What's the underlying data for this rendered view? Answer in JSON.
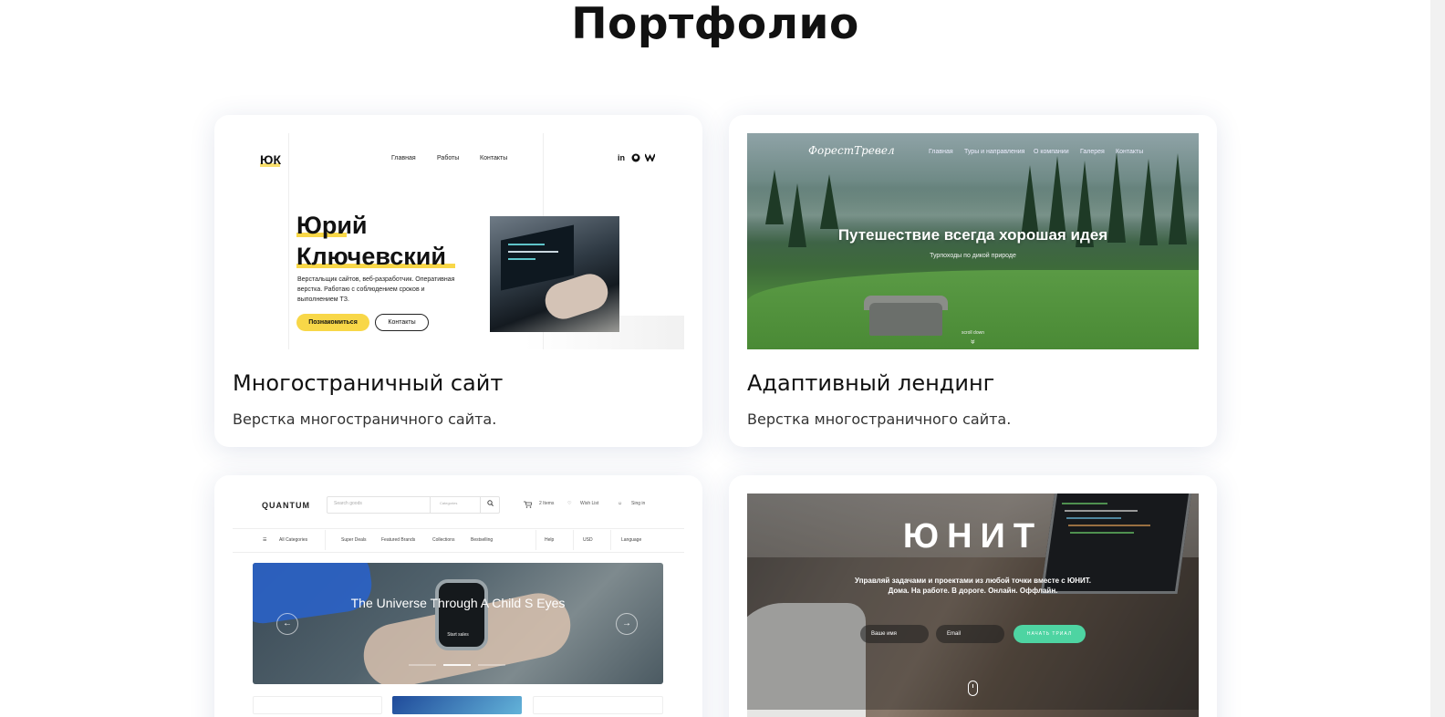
{
  "page": {
    "title": "Портфолио"
  },
  "cards": [
    {
      "title": "Многостраничный сайт",
      "desc": "Верстка многостраничного сайта.",
      "preview": {
        "logo": "ЮК",
        "nav": [
          "Главная",
          "Работы",
          "Контакты"
        ],
        "social": [
          "in",
          "gh",
          "vk"
        ],
        "name_line1": "Юрий",
        "name_line2": "Ключевский",
        "text": "Верстальщик сайтов, веб-разработчик. Оперативная верстка. Работаю с соблюдением сроков и выполнением ТЗ.",
        "btn_primary": "Познакомиться",
        "btn_secondary": "Контакты",
        "accent": "#f8d748"
      }
    },
    {
      "title": "Адаптивный лендинг",
      "desc": "Верстка многостраничного сайта.",
      "preview": {
        "logo": "ФорестТревел",
        "nav": [
          "Главная",
          "Туры и направления",
          "О компании",
          "Галерея",
          "Контакты"
        ],
        "hero": "Путешествие всегда хорошая идея",
        "sub": "Турпоходы по дикой природе",
        "scroll": "scroll down",
        "arrow": "»"
      }
    },
    {
      "title": "",
      "desc": "",
      "preview": {
        "logo": "QUANTUM",
        "search_placeholder": "Search goods",
        "search_category": "Categories",
        "cart": "2 Items",
        "wishlist": "Wish List",
        "signin": "Sing in",
        "categories": [
          "All Categories",
          "Super Deals",
          "Featured Brands",
          "Collections",
          "Bestselling"
        ],
        "selects": [
          "Help",
          "USD",
          "Language"
        ],
        "hero_title": "The Universe Through A Child S Eyes",
        "hero_sub": "Start sales",
        "accent": "#2a62c6"
      }
    },
    {
      "title": "",
      "desc": "",
      "preview": {
        "brand": "ЮНИТ",
        "tagline_1": "Управляй задачами и проектами из любой точки вместе с ЮНИТ.",
        "tagline_2": "Дома. На работе. В дороге. Онлайн. Оффлайн.",
        "field_name": "Ваше имя",
        "field_email": "Email",
        "cta": "НАЧАТЬ ТРИАЛ",
        "accent": "#4ed4a2"
      }
    }
  ]
}
